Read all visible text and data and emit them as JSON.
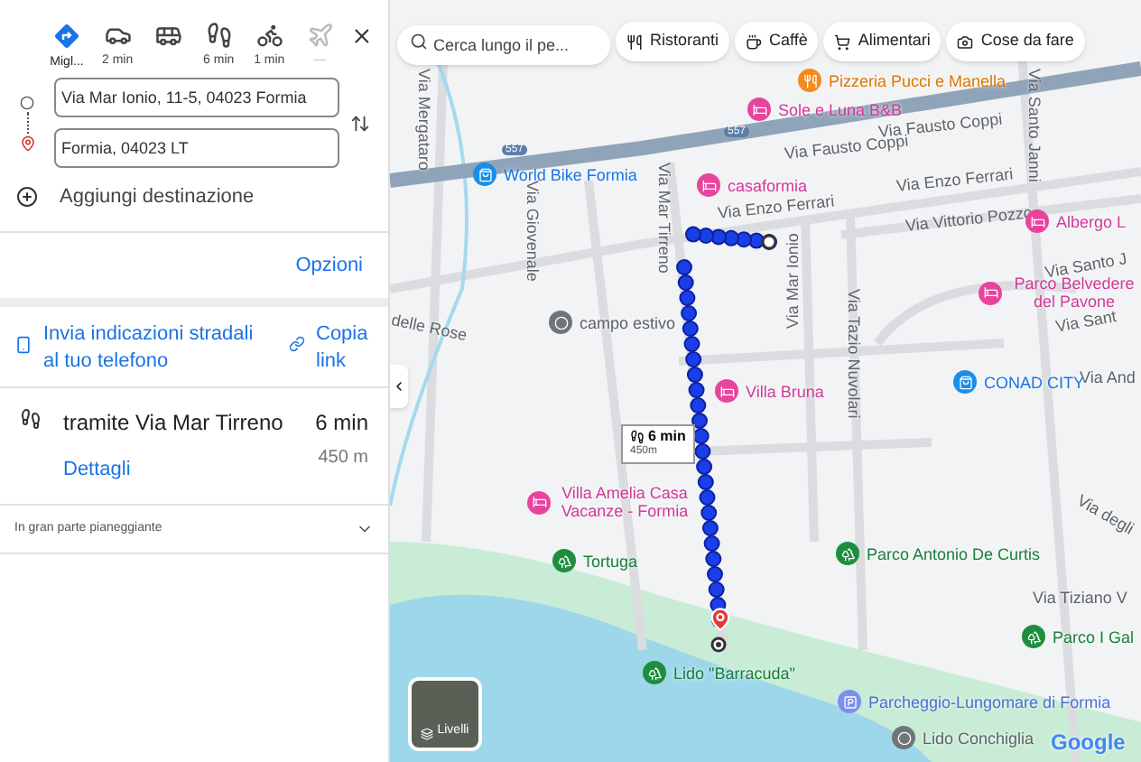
{
  "modes": [
    {
      "label": "Migl...",
      "kind": "best",
      "selected": true,
      "disabled": false
    },
    {
      "label": "2 min",
      "kind": "car",
      "selected": false,
      "disabled": false
    },
    {
      "kind": "transit",
      "selected": false,
      "disabled": false
    },
    {
      "label": "6 min",
      "kind": "walk",
      "selected": false,
      "disabled": false
    },
    {
      "label": "1 min",
      "kind": "bike",
      "selected": false,
      "disabled": false
    },
    {
      "label": "—",
      "kind": "plane",
      "selected": false,
      "disabled": true
    }
  ],
  "origin": {
    "value": "Via Mar Ionio, 11-5, 04023 Formia"
  },
  "destination": {
    "value": "Formia, 04023 LT"
  },
  "add_destination": "Aggiungi destinazione",
  "options": "Opzioni",
  "send_to_phone": "Invia indicazioni stradali al tuo telefono",
  "copy_link": "Copia link",
  "route": {
    "via": "tramite Via Mar Tirreno",
    "time": "6 min",
    "distance": "450 m",
    "details": "Dettagli"
  },
  "terrain": {
    "text": "In gran parte pianeggiante",
    "expanded": false
  },
  "map": {
    "search": {
      "placeholder": "Cerca lungo il pe..."
    },
    "chips": [
      "Ristoranti",
      "Caffè",
      "Alimentari",
      "Cose da fare"
    ],
    "callout": {
      "time": "6 min",
      "distance": "450m"
    },
    "road_shields": [
      "557",
      "557"
    ],
    "labels": [
      {
        "text": "Pizzeria Pucci e Manella",
        "kind": "food"
      },
      {
        "text": "Sole e Luna B&B",
        "kind": "hotel"
      },
      {
        "text": "World Bike Formia",
        "kind": "shop"
      },
      {
        "text": "Via Fausto Coppi",
        "kind": "street"
      },
      {
        "text": "Via Fausto Coppi",
        "kind": "street"
      },
      {
        "text": "casaformia",
        "kind": "hotel"
      },
      {
        "text": "Via Enzo Ferrari",
        "kind": "street"
      },
      {
        "text": "Via Enzo Ferrari",
        "kind": "street"
      },
      {
        "text": "Via Vittorio Pozzo",
        "kind": "street"
      },
      {
        "text": "Albergo L",
        "kind": "hotel"
      },
      {
        "text": "Via Santo Janni",
        "kind": "street"
      },
      {
        "text": "Via Mar Tirreno",
        "kind": "street"
      },
      {
        "text": "Via Giovenale",
        "kind": "street"
      },
      {
        "text": "Via Mar Ionio",
        "kind": "street"
      },
      {
        "text": "Via Tazio Nuvolari",
        "kind": "street"
      },
      {
        "text": "Via Mergataro",
        "kind": "street"
      },
      {
        "text": "delle Rose",
        "kind": "street"
      },
      {
        "text": "campo estivo",
        "kind": "place"
      },
      {
        "text": "Villa Bruna",
        "kind": "hotel"
      },
      {
        "text": "Parco Belvedere del Pavone",
        "kind": "hotel"
      },
      {
        "text": "Via Santo J",
        "kind": "street"
      },
      {
        "text": "Via Sant",
        "kind": "street"
      },
      {
        "text": "Via And",
        "kind": "street"
      },
      {
        "text": "CONAD CITY",
        "kind": "shop"
      },
      {
        "text": "Villa Amelia Casa Vacanze - Formia",
        "kind": "hotel"
      },
      {
        "text": "Tortuga",
        "kind": "park"
      },
      {
        "text": "Parco Antonio De Curtis",
        "kind": "park"
      },
      {
        "text": "Via degli",
        "kind": "street"
      },
      {
        "text": "Via Tiziano V",
        "kind": "street"
      },
      {
        "text": "Parco I Gal",
        "kind": "park"
      },
      {
        "text": "Lido \"Barracuda\"",
        "kind": "park"
      },
      {
        "text": "Parcheggio-Lungomare di Formia",
        "kind": "parking"
      },
      {
        "text": "Lido Conchiglia",
        "kind": "place"
      }
    ],
    "layers": "Livelli",
    "logo": "Google"
  }
}
